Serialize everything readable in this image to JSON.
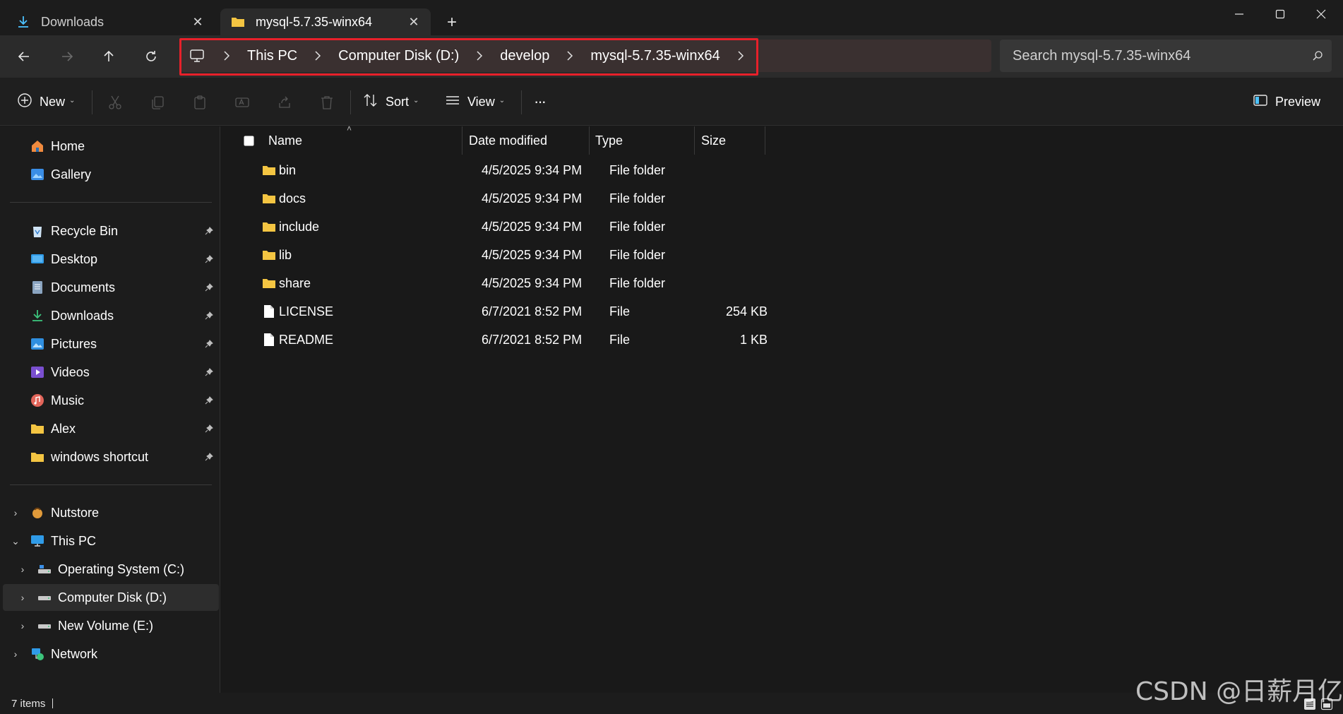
{
  "tabs": [
    {
      "label": "Downloads",
      "icon": "download-icon",
      "active": false
    },
    {
      "label": "mysql-5.7.35-winx64",
      "icon": "folder-icon",
      "active": true
    }
  ],
  "breadcrumb": [
    "This PC",
    "Computer Disk (D:)",
    "develop",
    "mysql-5.7.35-winx64"
  ],
  "search": {
    "placeholder": "Search mysql-5.7.35-winx64"
  },
  "commands": {
    "new": "New",
    "sort": "Sort",
    "view": "View",
    "more": "···",
    "preview": "Preview"
  },
  "nav": {
    "quick": [
      {
        "label": "Home",
        "icon": "home-icon"
      },
      {
        "label": "Gallery",
        "icon": "gallery-icon"
      }
    ],
    "pinned": [
      {
        "label": "Recycle Bin",
        "icon": "recycle-bin-icon"
      },
      {
        "label": "Desktop",
        "icon": "desktop-icon"
      },
      {
        "label": "Documents",
        "icon": "documents-icon"
      },
      {
        "label": "Downloads",
        "icon": "download-icon"
      },
      {
        "label": "Pictures",
        "icon": "pictures-icon"
      },
      {
        "label": "Videos",
        "icon": "videos-icon"
      },
      {
        "label": "Music",
        "icon": "music-icon"
      },
      {
        "label": "Alex",
        "icon": "folder-icon"
      },
      {
        "label": "windows shortcut",
        "icon": "folder-icon"
      }
    ],
    "tree": [
      {
        "label": "Nutstore",
        "icon": "nutstore-icon"
      },
      {
        "label": "This PC",
        "icon": "pc-icon"
      },
      {
        "label": "Operating System (C:)",
        "icon": "drive-icon"
      },
      {
        "label": "Computer Disk (D:)",
        "icon": "drive-icon"
      },
      {
        "label": "New Volume (E:)",
        "icon": "drive-icon"
      },
      {
        "label": "Network",
        "icon": "network-icon"
      }
    ]
  },
  "columns": {
    "name": "Name",
    "date": "Date modified",
    "type": "Type",
    "size": "Size"
  },
  "files": [
    {
      "name": "bin",
      "date": "4/5/2025 9:34 PM",
      "type": "File folder",
      "size": "",
      "kind": "folder"
    },
    {
      "name": "docs",
      "date": "4/5/2025 9:34 PM",
      "type": "File folder",
      "size": "",
      "kind": "folder"
    },
    {
      "name": "include",
      "date": "4/5/2025 9:34 PM",
      "type": "File folder",
      "size": "",
      "kind": "folder"
    },
    {
      "name": "lib",
      "date": "4/5/2025 9:34 PM",
      "type": "File folder",
      "size": "",
      "kind": "folder"
    },
    {
      "name": "share",
      "date": "4/5/2025 9:34 PM",
      "type": "File folder",
      "size": "",
      "kind": "folder"
    },
    {
      "name": "LICENSE",
      "date": "6/7/2021 8:52 PM",
      "type": "File",
      "size": "254 KB",
      "kind": "file"
    },
    {
      "name": "README",
      "date": "6/7/2021 8:52 PM",
      "type": "File",
      "size": "1 KB",
      "kind": "file"
    }
  ],
  "status": {
    "count": "7 items"
  },
  "watermark": "CSDN @日薪月亿",
  "colors": {
    "highlight": "#e8202a",
    "folder": "#f4c542",
    "accent": "#4cc2ff"
  }
}
